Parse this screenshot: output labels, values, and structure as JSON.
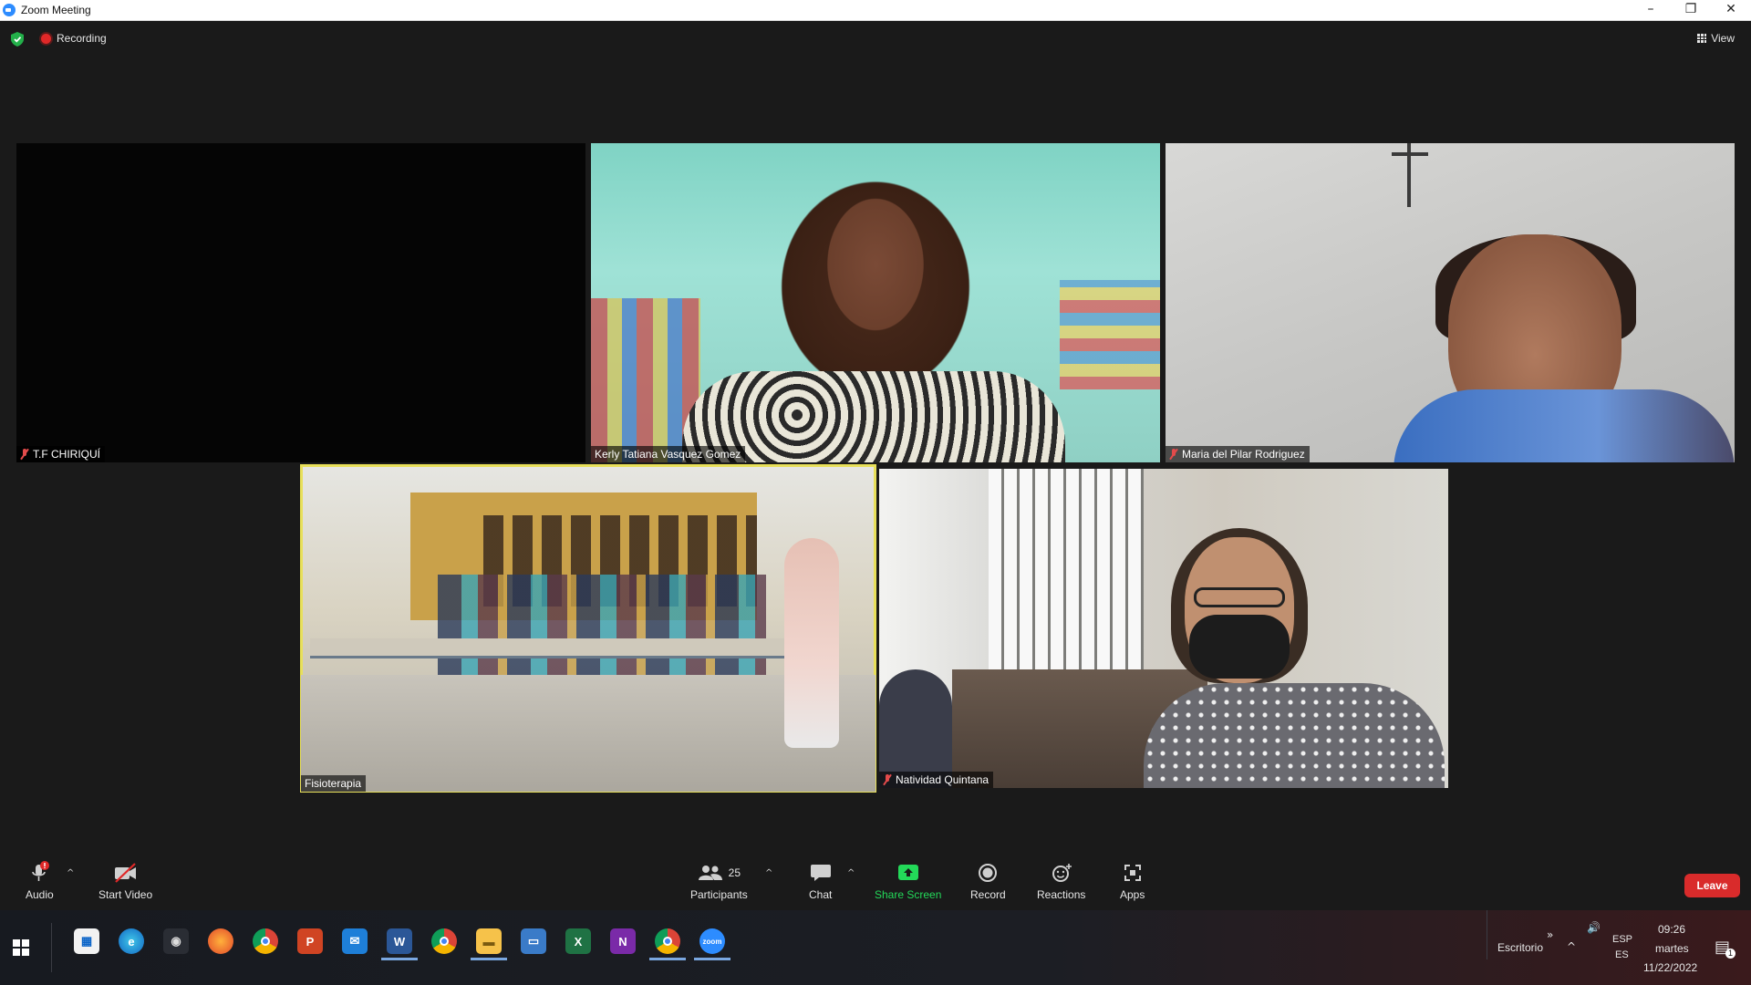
{
  "window": {
    "title": "Zoom Meeting",
    "controls": {
      "minimize": "–",
      "restore": "❐",
      "close": "✕"
    }
  },
  "meeting": {
    "recording_label": "Recording",
    "view_label": "View",
    "participants": [
      {
        "name": "T.F CHIRIQUÍ",
        "muted": true
      },
      {
        "name": "Kerly Tatiana Vasquez Gomez",
        "muted": false
      },
      {
        "name": "Maria del Pilar Rodriguez",
        "muted": true
      },
      {
        "name": "Fisioterapia",
        "muted": false,
        "active_speaker": true
      },
      {
        "name": "Natividad Quintana",
        "muted": true
      }
    ]
  },
  "toolbar": {
    "audio_label": "Audio",
    "start_video_label": "Start Video",
    "participants_label": "Participants",
    "participants_count": "25",
    "chat_label": "Chat",
    "share_screen_label": "Share Screen",
    "record_label": "Record",
    "reactions_label": "Reactions",
    "apps_label": "Apps",
    "leave_label": "Leave"
  },
  "taskbar": {
    "apps": [
      "store-icon",
      "edge-icon",
      "camera-icon",
      "firefox-icon",
      "chrome-icon",
      "powerpoint-icon",
      "mail-icon",
      "word-icon",
      "chrome-profile-icon",
      "file-explorer-icon",
      "remote-desktop-icon",
      "excel-icon",
      "onenote-icon",
      "chrome-alt-icon",
      "zoom-icon"
    ],
    "desktop_label": "Escritorio",
    "lang_top": "ESP",
    "lang_bottom": "ES",
    "time": "09:26",
    "day": "martes",
    "date": "11/22/2022",
    "notification_count": "1"
  },
  "colors": {
    "meeting_bg": "#1a1a1a",
    "speaker_border": "#e8e05a",
    "leave_bg": "#d92b2b",
    "share_green": "#23d959",
    "zoom_blue": "#2d8cff"
  }
}
